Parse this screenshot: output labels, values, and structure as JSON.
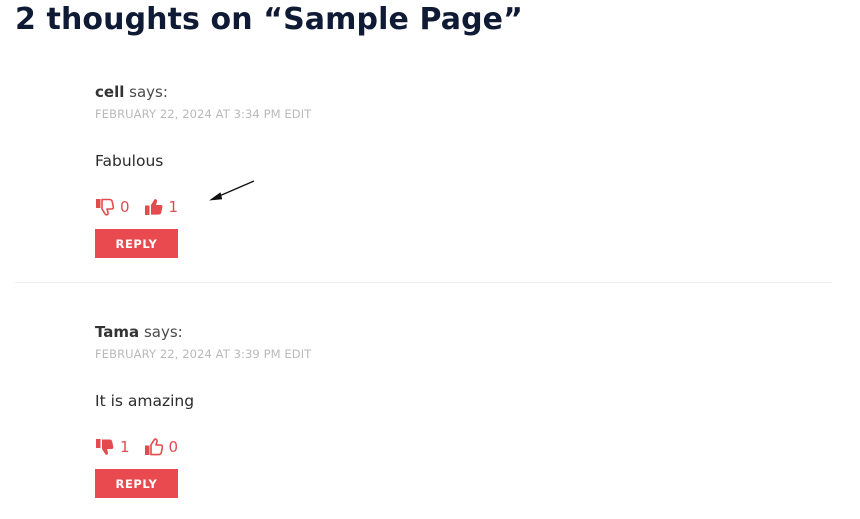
{
  "heading": "2 thoughts on “Sample Page”",
  "comments": [
    {
      "author": "cell",
      "says": "says:",
      "date": "February 22, 2024 at 3:34 pm",
      "edit": "Edit",
      "text": "Fabulous",
      "dislikes": "0",
      "likes": "1",
      "dislike_icon": "thumbs-down-outline-icon",
      "like_icon": "thumbs-up-filled-icon",
      "reply": "REPLY"
    },
    {
      "author": "Tama",
      "says": "says:",
      "date": "February 22, 2024 at 3:39 pm",
      "edit": "Edit",
      "text": "It is amazing",
      "dislikes": "1",
      "likes": "0",
      "dislike_icon": "thumbs-down-filled-icon",
      "like_icon": "thumbs-up-outline-icon",
      "reply": "REPLY"
    }
  ],
  "colors": {
    "accent": "#e84a4f",
    "heading": "#0f1b35",
    "meta": "#b9b9b9",
    "divider": "#ececec"
  }
}
